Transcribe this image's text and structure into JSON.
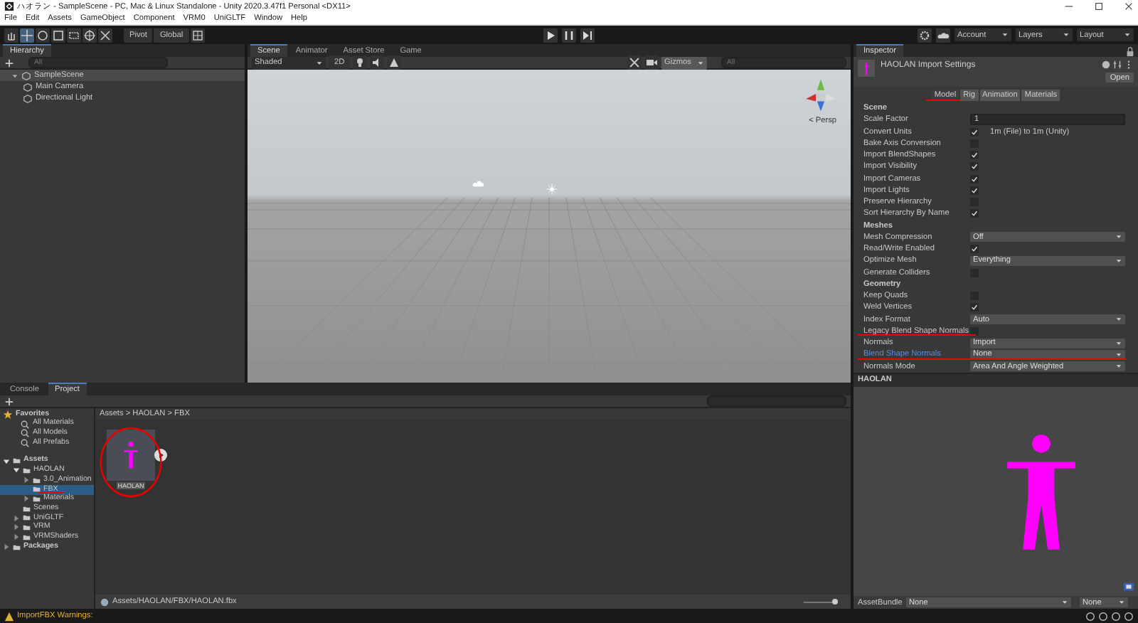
{
  "window": {
    "title": "ハオラン - SampleScene - PC, Mac & Linux Standalone - Unity 2020.3.47f1 Personal <DX11>"
  },
  "menu": [
    "File",
    "Edit",
    "Assets",
    "GameObject",
    "Component",
    "VRM0",
    "UniGLTF",
    "Window",
    "Help"
  ],
  "toolbar": {
    "pivot": "Pivot",
    "global": "Global",
    "account": "Account",
    "layers": "Layers",
    "layout": "Layout"
  },
  "hierarchy": {
    "title": "Hierarchy",
    "search_placeholder": "All",
    "tree": [
      {
        "label": "SampleScene",
        "expanded": true,
        "children": [
          {
            "label": "Main Camera"
          },
          {
            "label": "Directional Light"
          }
        ]
      }
    ]
  },
  "scene": {
    "tabs": [
      {
        "label": "Scene",
        "selected": true
      },
      {
        "label": "Animator",
        "selected": false
      },
      {
        "label": "Asset Store",
        "selected": false
      },
      {
        "label": "Game",
        "selected": false
      }
    ],
    "shading": "Shaded",
    "mode": "2D",
    "gizmos": "Gizmos",
    "search_placeholder": "All",
    "projection": "< Persp"
  },
  "inspector": {
    "title": "Inspector",
    "asset_title": "HAOLAN Import Settings",
    "open_button": "Open",
    "tabs": [
      {
        "label": "Model",
        "selected": true,
        "highlighted": true
      },
      {
        "label": "Rig",
        "selected": false,
        "highlighted": false
      },
      {
        "label": "Animation",
        "selected": false,
        "highlighted": false
      },
      {
        "label": "Materials",
        "selected": false,
        "highlighted": false
      }
    ],
    "rows": [
      {
        "kind": "header",
        "label": "Scene"
      },
      {
        "kind": "text",
        "label": "Scale Factor",
        "value": "1",
        "highlighted": false
      },
      {
        "kind": "check",
        "label": "Convert Units",
        "checked": true,
        "note": "1m (File) to 1m (Unity)",
        "highlighted": false
      },
      {
        "kind": "check",
        "label": "Bake Axis Conversion",
        "checked": false,
        "highlighted": false
      },
      {
        "kind": "check",
        "label": "Import BlendShapes",
        "checked": true,
        "highlighted": false
      },
      {
        "kind": "check",
        "label": "Import Visibility",
        "checked": true,
        "highlighted": false
      },
      {
        "kind": "check",
        "label": "Import Cameras",
        "checked": true,
        "highlighted": false
      },
      {
        "kind": "check",
        "label": "Import Lights",
        "checked": true,
        "highlighted": false
      },
      {
        "kind": "check",
        "label": "Preserve Hierarchy",
        "checked": false,
        "highlighted": false
      },
      {
        "kind": "check",
        "label": "Sort Hierarchy By Name",
        "checked": true,
        "highlighted": false
      },
      {
        "kind": "header",
        "label": "Meshes"
      },
      {
        "kind": "dropdown",
        "label": "Mesh Compression",
        "value": "Off",
        "highlighted": false
      },
      {
        "kind": "check",
        "label": "Read/Write Enabled",
        "checked": true,
        "highlighted": false
      },
      {
        "kind": "dropdown",
        "label": "Optimize Mesh",
        "value": "Everything",
        "highlighted": false
      },
      {
        "kind": "check",
        "label": "Generate Colliders",
        "checked": false,
        "highlighted": false
      },
      {
        "kind": "header",
        "label": "Geometry"
      },
      {
        "kind": "check",
        "label": "Keep Quads",
        "checked": false,
        "highlighted": false
      },
      {
        "kind": "check",
        "label": "Weld Vertices",
        "checked": true,
        "highlighted": false
      },
      {
        "kind": "dropdown",
        "label": "Index Format",
        "value": "Auto",
        "highlighted": false
      },
      {
        "kind": "check",
        "label": "Legacy Blend Shape Normals",
        "checked": false,
        "highlighted": true
      },
      {
        "kind": "dropdown",
        "label": "Normals",
        "value": "Import",
        "highlighted": false
      },
      {
        "kind": "dropdown",
        "label": "Blend Shape Normals",
        "value": "None",
        "highlighted": true
      },
      {
        "kind": "dropdown",
        "label": "Normals Mode",
        "value": "Area And Angle Weighted",
        "highlighted": false
      }
    ],
    "preview_title": "HAOLAN",
    "asset_bundle_label": "AssetBundle",
    "asset_bundle": "None",
    "asset_variant": "None"
  },
  "project": {
    "tabs": [
      {
        "label": "Console",
        "selected": false
      },
      {
        "label": "Project",
        "selected": true
      }
    ],
    "favorites": {
      "label": "Favorites",
      "items": [
        "All Materials",
        "All Models",
        "All Prefabs"
      ]
    },
    "tree": [
      {
        "label": "Assets",
        "expanded": true,
        "selected": false,
        "highlighted": false,
        "children": [
          {
            "label": "HAOLAN",
            "expanded": true,
            "selected": false,
            "highlighted": false,
            "children": [
              {
                "label": "3.0_Animation",
                "expanded": false,
                "selected": false,
                "highlighted": false
              },
              {
                "label": "FBX",
                "selected": true,
                "highlighted": true
              },
              {
                "label": "Materials",
                "expanded": false,
                "selected": false,
                "highlighted": false
              }
            ]
          },
          {
            "label": "Scenes",
            "selected": false,
            "highlighted": false
          },
          {
            "label": "UniGLTF",
            "expanded": false,
            "selected": false,
            "highlighted": false
          },
          {
            "label": "VRM",
            "expanded": false,
            "selected": false,
            "highlighted": false
          },
          {
            "label": "VRMShaders",
            "expanded": false,
            "selected": false,
            "highlighted": false
          }
        ]
      },
      {
        "label": "Packages",
        "expanded": false,
        "selected": false,
        "highlighted": false
      }
    ],
    "breadcrumb": "Assets > HAOLAN > FBX",
    "assets": [
      {
        "label": "HAOLAN",
        "highlighted": true
      }
    ],
    "path": "Assets/HAOLAN/FBX/HAOLAN.fbx",
    "zoom_slider": {
      "level": 1
    }
  },
  "status_bar": {
    "message": "ImportFBX Warnings:"
  }
}
